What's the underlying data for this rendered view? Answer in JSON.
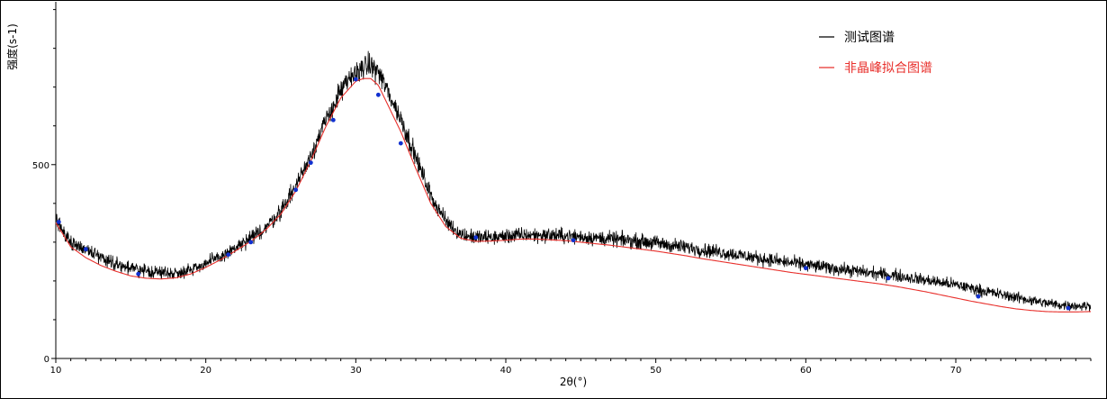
{
  "chart_data": {
    "type": "line",
    "title": "",
    "xlabel": "2θ(°)",
    "ylabel": "强度(s-1)",
    "xlim": [
      10,
      79
    ],
    "ylim": [
      0,
      920
    ],
    "x_ticks": [
      10,
      20,
      30,
      40,
      50,
      60,
      70
    ],
    "y_ticks": [
      0,
      500
    ],
    "x_minor_step": 1,
    "y_minor_step": 100,
    "grid": false,
    "legend_position": "top-right",
    "series": [
      {
        "name": "测试图谱",
        "color": "#000000",
        "style": "noisy",
        "x": [
          10,
          11,
          12,
          13,
          14,
          15,
          16,
          17,
          18,
          19,
          20,
          21,
          22,
          23,
          24,
          25,
          26,
          27,
          28,
          29,
          30,
          30.5,
          31,
          31.5,
          32,
          33,
          34,
          35,
          36,
          37,
          38,
          39,
          40,
          41,
          42,
          43,
          44,
          45,
          46,
          47,
          48,
          49,
          50,
          51,
          52,
          53,
          54,
          55,
          56,
          57,
          58,
          59,
          60,
          61,
          62,
          63,
          64,
          65,
          66,
          67,
          68,
          69,
          70,
          71,
          72,
          73,
          74,
          75,
          76,
          77,
          78,
          79
        ],
        "values": [
          355,
          300,
          282,
          262,
          245,
          232,
          225,
          222,
          220,
          230,
          245,
          262,
          285,
          308,
          338,
          380,
          445,
          525,
          612,
          690,
          738,
          752,
          755,
          740,
          700,
          618,
          520,
          420,
          355,
          320,
          312,
          312,
          315,
          318,
          318,
          318,
          316,
          314,
          311,
          308,
          305,
          302,
          298,
          292,
          287,
          281,
          276,
          270,
          264,
          258,
          252,
          247,
          242,
          237,
          232,
          227,
          222,
          218,
          214,
          208,
          202,
          196,
          190,
          182,
          173,
          165,
          158,
          150,
          143,
          138,
          136,
          135
        ]
      },
      {
        "name": "非晶峰拟合图谱",
        "color": "#e8302c",
        "style": "smooth",
        "x": [
          10,
          11,
          12,
          13,
          14,
          15,
          16,
          17,
          18,
          19,
          20,
          21,
          22,
          23,
          24,
          25,
          26,
          27,
          28,
          29,
          30,
          30.5,
          31,
          31.5,
          32,
          33,
          34,
          35,
          36,
          37,
          38,
          39,
          40,
          41,
          42,
          43,
          44,
          45,
          46,
          47,
          48,
          49,
          50,
          51,
          52,
          53,
          54,
          55,
          56,
          57,
          58,
          59,
          60,
          61,
          62,
          63,
          64,
          65,
          66,
          67,
          68,
          69,
          70,
          71,
          72,
          73,
          74,
          75,
          76,
          77,
          78,
          79
        ],
        "values": [
          350,
          288,
          260,
          240,
          225,
          213,
          207,
          205,
          208,
          218,
          235,
          255,
          278,
          302,
          332,
          372,
          432,
          510,
          598,
          672,
          715,
          722,
          722,
          705,
          665,
          585,
          490,
          400,
          340,
          310,
          302,
          303,
          305,
          308,
          308,
          306,
          304,
          300,
          296,
          292,
          287,
          282,
          277,
          271,
          265,
          258,
          252,
          246,
          240,
          234,
          228,
          222,
          217,
          212,
          207,
          202,
          197,
          192,
          186,
          179,
          172,
          164,
          156,
          148,
          141,
          134,
          128,
          124,
          121,
          120,
          120,
          121
        ]
      }
    ],
    "markers": {
      "color": "#1030d0",
      "x": [
        10.2,
        12,
        15.5,
        21.5,
        23,
        26,
        27,
        28.5,
        30,
        31.5,
        33,
        38,
        44.5,
        60,
        65.5,
        71.5,
        77.5
      ],
      "values": [
        352,
        282,
        218,
        268,
        300,
        435,
        505,
        615,
        720,
        680,
        555,
        312,
        305,
        233,
        207,
        160,
        130
      ]
    }
  }
}
